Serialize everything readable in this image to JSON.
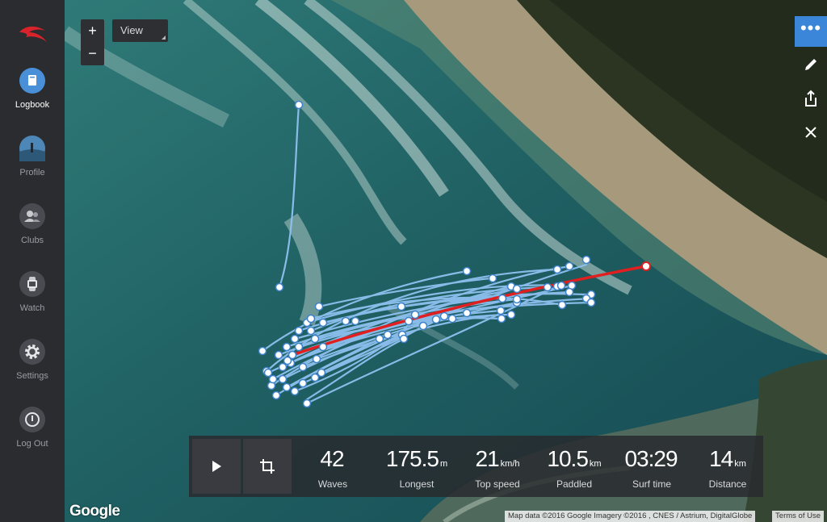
{
  "sidebar": {
    "items": [
      {
        "label": "Logbook",
        "icon": "logbook-icon",
        "active": true
      },
      {
        "label": "Profile",
        "icon": "profile-avatar",
        "active": false
      },
      {
        "label": "Clubs",
        "icon": "clubs-icon",
        "active": false
      },
      {
        "label": "Watch",
        "icon": "watch-icon",
        "active": false
      },
      {
        "label": "Settings",
        "icon": "gear-icon",
        "active": false
      },
      {
        "label": "Log Out",
        "icon": "logout-icon",
        "active": false
      }
    ]
  },
  "map": {
    "zoom_in": "+",
    "zoom_out": "−",
    "view_label": "View",
    "more_label": "•••",
    "google_logo": "Google",
    "attribution": "Map data ©2016 Google Imagery ©2016 , CNES / Astrium, DigitalGlobe",
    "terms": "Terms of Use"
  },
  "stats": [
    {
      "value": "42",
      "unit": "",
      "label": "Waves"
    },
    {
      "value": "175.5",
      "unit": "m",
      "label": "Longest"
    },
    {
      "value": "21",
      "unit": "km/h",
      "label": "Top speed"
    },
    {
      "value": "10.5",
      "unit": "km",
      "label": "Paddled"
    },
    {
      "value": "03:29",
      "unit": "",
      "label": "Surf time"
    },
    {
      "value": "14",
      "unit": "km",
      "label": "Distance"
    }
  ],
  "colors": {
    "accent": "#3b86d8",
    "track": "#8ec1f0",
    "longest_track": "#e02020"
  }
}
